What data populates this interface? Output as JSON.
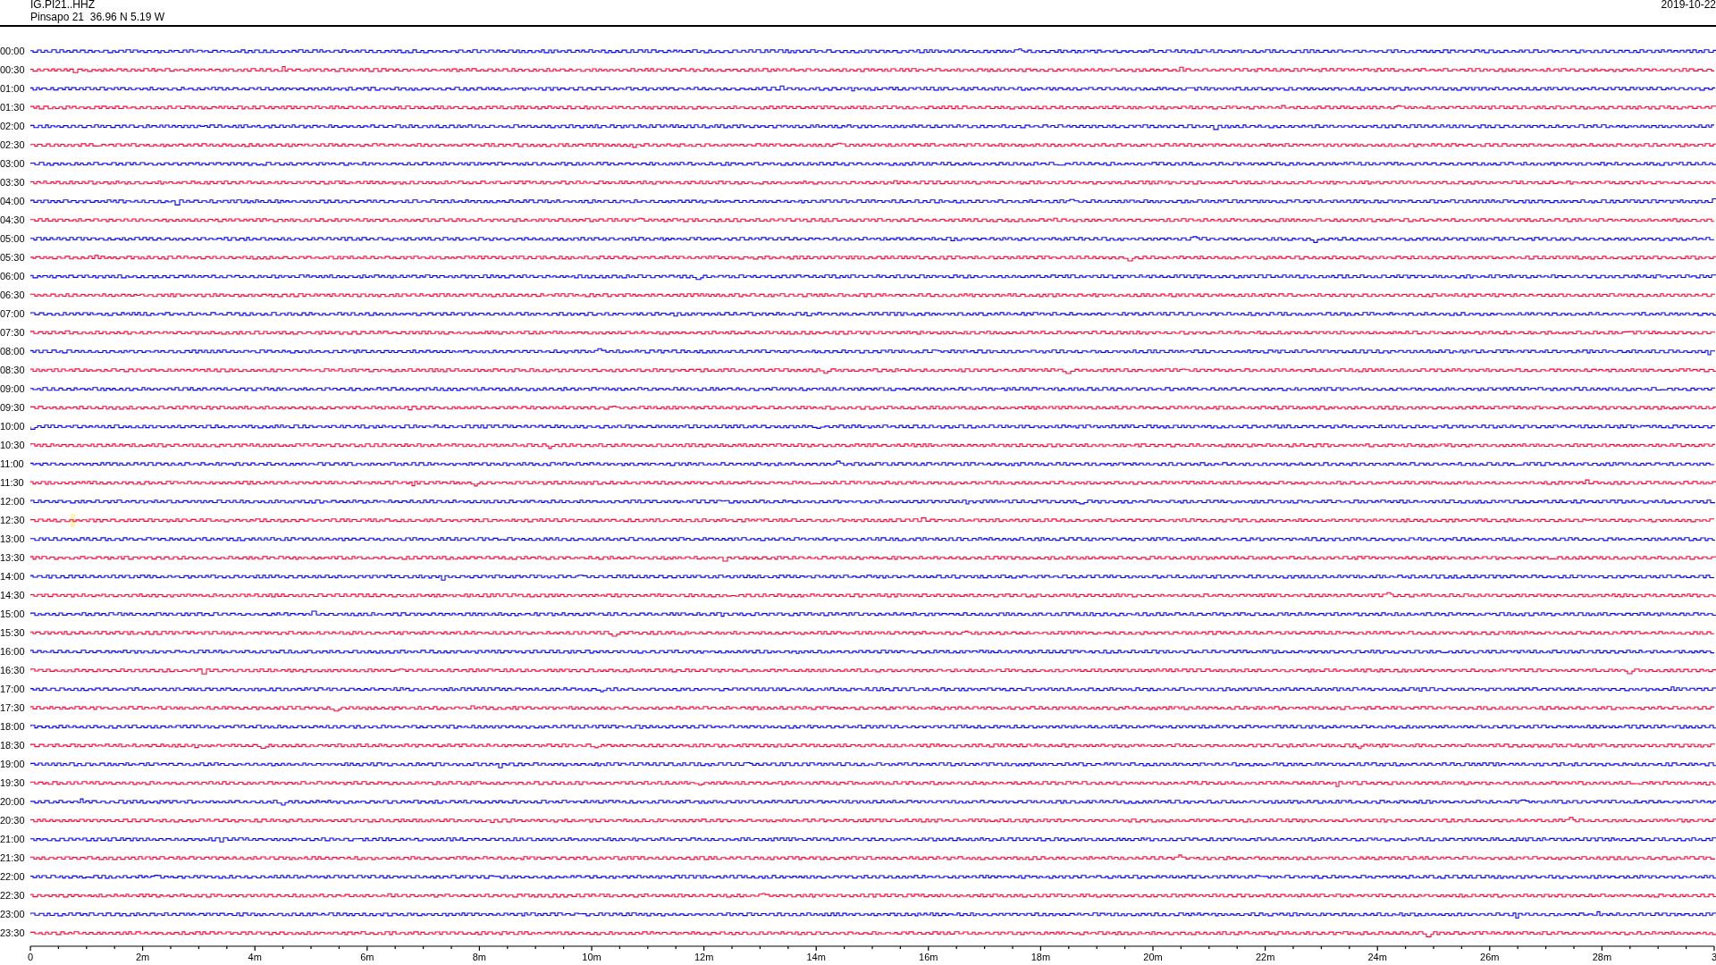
{
  "header": {
    "channel": "IG.PI21..HHZ",
    "station": "Pinsapo 21  36.96 N 5.19 W",
    "date": "2019-10-22"
  },
  "traces": [
    {
      "time": "00:00",
      "color": "#0000ff",
      "highlight": false
    },
    {
      "time": "00:30",
      "color": "#ff0033",
      "highlight": false
    },
    {
      "time": "01:00",
      "color": "#0000ff",
      "highlight": false
    },
    {
      "time": "01:30",
      "color": "#ff0033",
      "highlight": false
    },
    {
      "time": "02:00",
      "color": "#0000ff",
      "highlight": false
    },
    {
      "time": "02:30",
      "color": "#ff0033",
      "highlight": false
    },
    {
      "time": "03:00",
      "color": "#0000ff",
      "highlight": false
    },
    {
      "time": "03:30",
      "color": "#ff0033",
      "highlight": false
    },
    {
      "time": "04:00",
      "color": "#0000ff",
      "highlight": false
    },
    {
      "time": "04:30",
      "color": "#ff0033",
      "highlight": false
    },
    {
      "time": "05:00",
      "color": "#0000ff",
      "highlight": false
    },
    {
      "time": "05:30",
      "color": "#ff0033",
      "highlight": false
    },
    {
      "time": "06:00",
      "color": "#0000ff",
      "highlight": false
    },
    {
      "time": "06:30",
      "color": "#ff0033",
      "highlight": false
    },
    {
      "time": "07:00",
      "color": "#0000ff",
      "highlight": false
    },
    {
      "time": "07:30",
      "color": "#ff0033",
      "highlight": false
    },
    {
      "time": "08:00",
      "color": "#0000ff",
      "highlight": false
    },
    {
      "time": "08:30",
      "color": "#ff0033",
      "highlight": false
    },
    {
      "time": "09:00",
      "color": "#0000ff",
      "highlight": false
    },
    {
      "time": "09:30",
      "color": "#ff0033",
      "highlight": false
    },
    {
      "time": "10:00",
      "color": "#0000ff",
      "highlight": false
    },
    {
      "time": "10:30",
      "color": "#ff0033",
      "highlight": false
    },
    {
      "time": "11:00",
      "color": "#0000ff",
      "highlight": false
    },
    {
      "time": "11:30",
      "color": "#ff0033",
      "highlight": false
    },
    {
      "time": "12:00",
      "color": "#0000ff",
      "highlight": false
    },
    {
      "time": "12:30",
      "color": "#ff0033",
      "highlight": true
    },
    {
      "time": "13:00",
      "color": "#0000ff",
      "highlight": false
    },
    {
      "time": "13:30",
      "color": "#ff0033",
      "highlight": false
    },
    {
      "time": "14:00",
      "color": "#0000ff",
      "highlight": false
    },
    {
      "time": "14:30",
      "color": "#ff0033",
      "highlight": false
    },
    {
      "time": "15:00",
      "color": "#0000ff",
      "highlight": false
    },
    {
      "time": "15:30",
      "color": "#ff0033",
      "highlight": false
    },
    {
      "time": "16:00",
      "color": "#0000ff",
      "highlight": false
    },
    {
      "time": "16:30",
      "color": "#ff0033",
      "highlight": false
    },
    {
      "time": "17:00",
      "color": "#0000ff",
      "highlight": false
    },
    {
      "time": "17:30",
      "color": "#ff0033",
      "highlight": false
    },
    {
      "time": "18:00",
      "color": "#0000ff",
      "highlight": false
    },
    {
      "time": "18:30",
      "color": "#ff0033",
      "highlight": false
    },
    {
      "time": "19:00",
      "color": "#0000ff",
      "highlight": false
    },
    {
      "time": "19:30",
      "color": "#ff0033",
      "highlight": false
    },
    {
      "time": "20:00",
      "color": "#0000ff",
      "highlight": false
    },
    {
      "time": "20:30",
      "color": "#ff0033",
      "highlight": false
    },
    {
      "time": "21:00",
      "color": "#0000ff",
      "highlight": false
    },
    {
      "time": "21:30",
      "color": "#ff0033",
      "highlight": false
    },
    {
      "time": "22:00",
      "color": "#0000ff",
      "highlight": false
    },
    {
      "time": "22:30",
      "color": "#ff0033",
      "highlight": false
    },
    {
      "time": "23:00",
      "color": "#0000ff",
      "highlight": false
    },
    {
      "time": "23:30",
      "color": "#ff0033",
      "highlight": false
    }
  ],
  "time_axis": {
    "labels": [
      "0",
      "2m",
      "4m",
      "6m",
      "8m",
      "10m",
      "12m",
      "14m",
      "16m",
      "18m",
      "20m",
      "22m",
      "24m",
      "26m",
      "28m",
      "3"
    ]
  }
}
